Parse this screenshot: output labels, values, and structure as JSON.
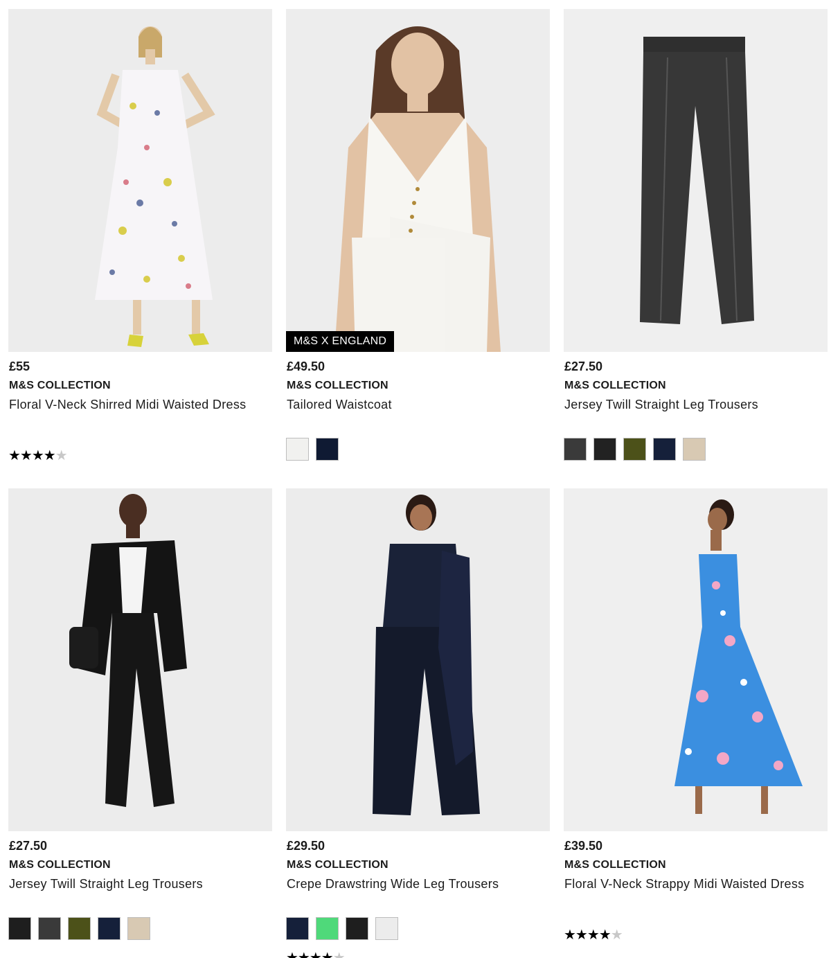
{
  "products": [
    {
      "price": "£55",
      "brand": "M&S COLLECTION",
      "name": "Floral V-Neck Shirred Midi Waisted Dress",
      "badge": "",
      "rating": 4.5,
      "image": "model-floral-dress",
      "swatches": []
    },
    {
      "price": "£49.50",
      "brand": "M&S COLLECTION",
      "name": "Tailored Waistcoat",
      "badge": "M&S X ENGLAND",
      "rating": null,
      "image": "model-white-waistcoat",
      "swatches": [
        "#f1f1ef",
        "#0f1a33"
      ]
    },
    {
      "price": "£27.50",
      "brand": "M&S COLLECTION",
      "name": "Jersey Twill Straight Leg Trousers",
      "badge": "",
      "rating": null,
      "image": "charcoal-trousers-flatlay",
      "swatches": [
        "#3a3a3a",
        "#222222",
        "#4c5119",
        "#15203a",
        "#d8c9b3"
      ]
    },
    {
      "price": "£27.50",
      "brand": "M&S COLLECTION",
      "name": "Jersey Twill Straight Leg Trousers",
      "badge": "",
      "rating": null,
      "image": "model-black-suit",
      "swatches": [
        "#1e1e1e",
        "#3a3a3a",
        "#4c5119",
        "#15203a",
        "#d8c9b3"
      ]
    },
    {
      "price": "£29.50",
      "brand": "M&S COLLECTION",
      "name": "Crepe Drawstring Wide Leg Trousers",
      "badge": "",
      "rating": 4.5,
      "image": "model-navy-wide-leg",
      "swatches": [
        "#15203a",
        "#4fd97a",
        "#1e1e1e",
        "#ececec"
      ]
    },
    {
      "price": "£39.50",
      "brand": "M&S COLLECTION",
      "name": "Floral V-Neck Strappy Midi Waisted Dress",
      "badge": "",
      "rating": 4.5,
      "image": "model-blue-strappy-dress",
      "swatches": []
    }
  ]
}
